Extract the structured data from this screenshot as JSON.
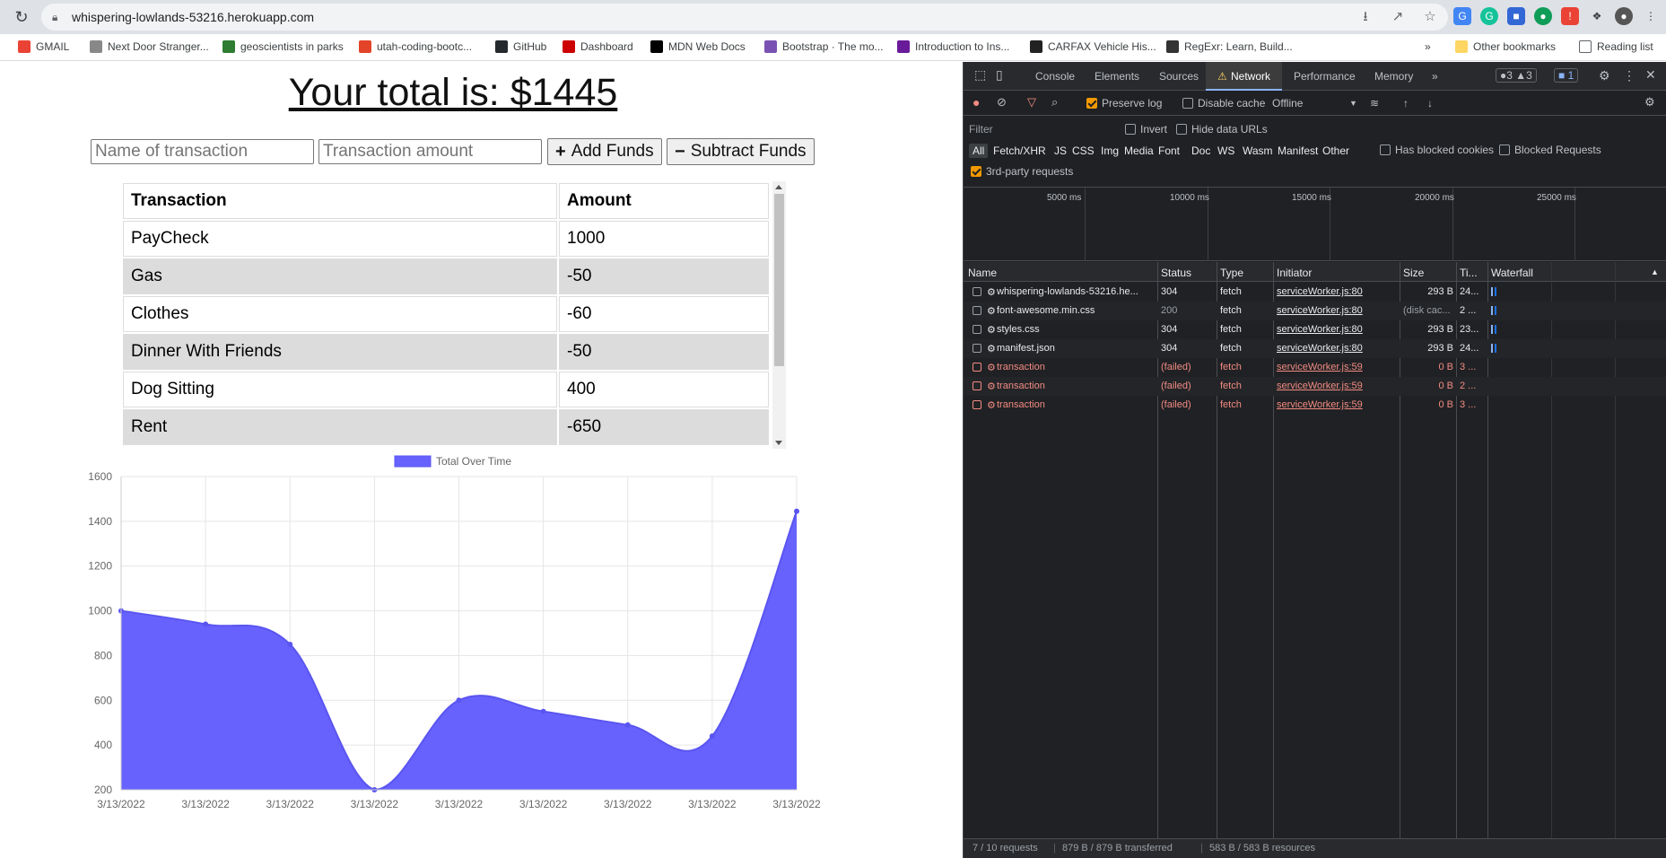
{
  "browser": {
    "url": "whispering-lowlands-53216.herokuapp.com",
    "bookmarks": [
      {
        "label": "GMAIL",
        "color": "#ea4335"
      },
      {
        "label": "Next Door Stranger...",
        "color": "#888888"
      },
      {
        "label": "geoscientists in parks",
        "color": "#2e7d32"
      },
      {
        "label": "utah-coding-bootc...",
        "color": "#e24329"
      },
      {
        "label": "GitHub",
        "color": "#24292e"
      },
      {
        "label": "Dashboard",
        "color": "#cc0000"
      },
      {
        "label": "MDN Web Docs",
        "color": "#000000"
      },
      {
        "label": "Bootstrap · The mo...",
        "color": "#7952b3"
      },
      {
        "label": "Introduction to Ins...",
        "color": "#6a1b9a"
      },
      {
        "label": "CARFAX Vehicle His...",
        "color": "#222222"
      },
      {
        "label": "RegExr: Learn, Build...",
        "color": "#333333"
      }
    ],
    "other_bookmarks": "Other bookmarks",
    "reading_list": "Reading list"
  },
  "app": {
    "total_label": "Your total is: $1445",
    "name_placeholder": "Name of transaction",
    "amount_placeholder": "Transaction amount",
    "add_label": "Add Funds",
    "subtract_label": "Subtract Funds",
    "table_headers": [
      "Transaction",
      "Amount"
    ],
    "transactions": [
      {
        "name": "PayCheck",
        "amount": "1000"
      },
      {
        "name": "Gas",
        "amount": "-50"
      },
      {
        "name": "Clothes",
        "amount": "-60"
      },
      {
        "name": "Dinner With Friends",
        "amount": "-50"
      },
      {
        "name": "Dog Sitting",
        "amount": "400"
      },
      {
        "name": "Rent",
        "amount": "-650"
      }
    ]
  },
  "chart_data": {
    "type": "area",
    "legend": "Total Over Time",
    "legend_position": "top",
    "x": [
      "3/13/2022",
      "3/13/2022",
      "3/13/2022",
      "3/13/2022",
      "3/13/2022",
      "3/13/2022",
      "3/13/2022",
      "3/13/2022",
      "3/13/2022"
    ],
    "series": [
      {
        "name": "Total Over Time",
        "values": [
          1000,
          940,
          850,
          200,
          600,
          550,
          490,
          440,
          1445
        ]
      }
    ],
    "ylim": [
      200,
      1600
    ],
    "yticks": [
      200,
      400,
      600,
      800,
      1000,
      1200,
      1400,
      1600
    ],
    "grid": true,
    "color": "#6762fe"
  },
  "devtools": {
    "tabs": [
      "Console",
      "Elements",
      "Sources",
      "Network",
      "Performance",
      "Memory"
    ],
    "active_tab": "Network",
    "badges": {
      "issues": "3",
      "warnings": "3",
      "messages": "1"
    },
    "toolbar": {
      "preserve_log": "Preserve log",
      "disable_cache": "Disable cache",
      "throttle": "Offline"
    },
    "filter_placeholder": "Filter",
    "invert": "Invert",
    "hide_data_urls": "Hide data URLs",
    "types": [
      "All",
      "Fetch/XHR",
      "JS",
      "CSS",
      "Img",
      "Media",
      "Font",
      "Doc",
      "WS",
      "Wasm",
      "Manifest",
      "Other"
    ],
    "has_blocked_cookies": "Has blocked cookies",
    "blocked_requests": "Blocked Requests",
    "third_party": "3rd-party requests",
    "timeline_ticks": [
      "5000 ms",
      "10000 ms",
      "15000 ms",
      "20000 ms",
      "25000 ms"
    ],
    "columns": [
      "Name",
      "Status",
      "Type",
      "Initiator",
      "Size",
      "Ti...",
      "Waterfall"
    ],
    "requests": [
      {
        "name": "whispering-lowlands-53216.he...",
        "status": "304",
        "type": "fetch",
        "initiator": "serviceWorker.js:80",
        "size": "293 B",
        "time": "24...",
        "failed": false
      },
      {
        "name": "font-awesome.min.css",
        "status": "200",
        "type": "fetch",
        "initiator": "serviceWorker.js:80",
        "size": "(disk cac...",
        "time": "2 ...",
        "failed": false
      },
      {
        "name": "styles.css",
        "status": "304",
        "type": "fetch",
        "initiator": "serviceWorker.js:80",
        "size": "293 B",
        "time": "23...",
        "failed": false
      },
      {
        "name": "manifest.json",
        "status": "304",
        "type": "fetch",
        "initiator": "serviceWorker.js:80",
        "size": "293 B",
        "time": "24...",
        "failed": false
      },
      {
        "name": "transaction",
        "status": "(failed)",
        "type": "fetch",
        "initiator": "serviceWorker.js:59",
        "size": "0 B",
        "time": "3 ...",
        "failed": true
      },
      {
        "name": "transaction",
        "status": "(failed)",
        "type": "fetch",
        "initiator": "serviceWorker.js:59",
        "size": "0 B",
        "time": "2 ...",
        "failed": true
      },
      {
        "name": "transaction",
        "status": "(failed)",
        "type": "fetch",
        "initiator": "serviceWorker.js:59",
        "size": "0 B",
        "time": "3 ...",
        "failed": true
      }
    ],
    "footer": {
      "requests": "7 / 10 requests",
      "transferred": "879 B / 879 B transferred",
      "resources": "583 B / 583 B resources"
    }
  }
}
